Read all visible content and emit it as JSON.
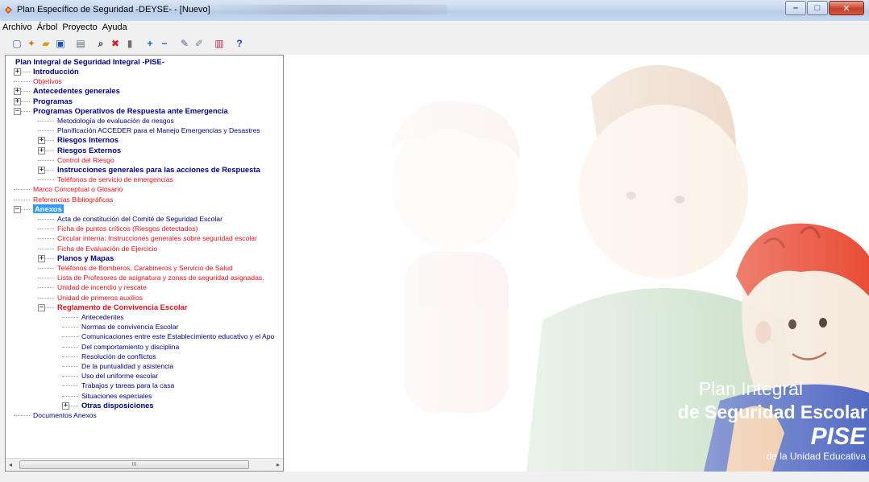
{
  "window": {
    "title": "Plan Específico de Seguridad -DEYSE- - [Nuevo]",
    "controls": {
      "minimize": "–",
      "maximize": "□",
      "close": "✕"
    }
  },
  "menu": [
    "Archivo",
    "Árbol",
    "Proyecto",
    "Ayuda"
  ],
  "toolbar": [
    {
      "icon": "new-document-icon",
      "glyph": "▢",
      "color": "#3060c0"
    },
    {
      "icon": "wand-icon",
      "glyph": "✦",
      "color": "#c08020"
    },
    {
      "icon": "open-folder-icon",
      "glyph": "▰",
      "color": "#d0a020"
    },
    {
      "icon": "save-icon",
      "glyph": "▣",
      "color": "#2050b0"
    },
    {
      "icon": "sep"
    },
    {
      "icon": "print-preview-icon",
      "glyph": "▤",
      "color": "#607080"
    },
    {
      "icon": "sep"
    },
    {
      "icon": "find-icon",
      "glyph": "⌕",
      "color": "#333333"
    },
    {
      "icon": "delete-icon",
      "glyph": "✖",
      "color": "#d02020"
    },
    {
      "icon": "trash-icon",
      "glyph": "▮",
      "color": "#707070"
    },
    {
      "icon": "sep"
    },
    {
      "icon": "add-node-icon",
      "glyph": "+",
      "color": "#1060d0"
    },
    {
      "icon": "remove-node-icon",
      "glyph": "−",
      "color": "#1060d0"
    },
    {
      "icon": "sep"
    },
    {
      "icon": "edit-icon",
      "glyph": "✎",
      "color": "#506080"
    },
    {
      "icon": "edit-text-icon",
      "glyph": "✐",
      "color": "#7080a0"
    },
    {
      "icon": "sep"
    },
    {
      "icon": "report-icon",
      "glyph": "▥",
      "color": "#c02060"
    },
    {
      "icon": "sep"
    },
    {
      "icon": "help-icon",
      "glyph": "?",
      "color": "#2040c0"
    }
  ],
  "tree": {
    "root": "Plan Integral de Seguridad Integral -PISE-",
    "nodes": [
      {
        "label": "Introducción",
        "level": 1,
        "style": "bold-blue",
        "expander": "+"
      },
      {
        "label": "Objetivos",
        "level": 1,
        "style": "red"
      },
      {
        "label": "Antecedentes generales",
        "level": 1,
        "style": "bold-blue",
        "expander": "+"
      },
      {
        "label": "Programas",
        "level": 1,
        "style": "bold-blue",
        "expander": "+"
      },
      {
        "label": "Programas Operativos de Respuesta ante Emergencia",
        "level": 1,
        "style": "bold-blue",
        "expander": "−"
      },
      {
        "label": "Metodología de evaluación de riesgos",
        "level": 2,
        "style": "blue"
      },
      {
        "label": "Planificación ACCEDER para el Manejo Emergencias y Desastres",
        "level": 2,
        "style": "blue"
      },
      {
        "label": "Riesgos Internos",
        "level": 2,
        "style": "bold-blue",
        "expander": "+"
      },
      {
        "label": "Riesgos Externos",
        "level": 2,
        "style": "bold-blue",
        "expander": "+"
      },
      {
        "label": "Control del Riesgo",
        "level": 2,
        "style": "red"
      },
      {
        "label": "Instrucciones generales para las acciones de Respuesta",
        "level": 2,
        "style": "bold-blue",
        "expander": "+"
      },
      {
        "label": "Teléfonos de servicio de emergencias",
        "level": 2,
        "style": "red"
      },
      {
        "label": "Marco Conceptual o Glosario",
        "level": 1,
        "style": "red"
      },
      {
        "label": "Referencias Bibliográficas",
        "level": 1,
        "style": "red"
      },
      {
        "label": "Anexos",
        "level": 1,
        "style": "bold-selected",
        "expander": "−"
      },
      {
        "label": "Acta de constitución del Comité de Seguridad Escolar",
        "level": 2,
        "style": "blue"
      },
      {
        "label": "Ficha de puntos críticos (Riesgos detectados)",
        "level": 2,
        "style": "red"
      },
      {
        "label": "Circular interna: Instrucciones generales sobre seguridad escolar",
        "level": 2,
        "style": "red"
      },
      {
        "label": "Ficha de Evaluación de Ejercicio",
        "level": 2,
        "style": "red"
      },
      {
        "label": "Planos y Mapas",
        "level": 2,
        "style": "bold-blue",
        "expander": "+"
      },
      {
        "label": "Teléfonos de Bomberos, Carabineros y Servicio de Salud",
        "level": 2,
        "style": "red"
      },
      {
        "label": "Lista de Profesores de asignatura y zonas de seguridad asignadas.",
        "level": 2,
        "style": "red"
      },
      {
        "label": "Unidad de incendio y rescate",
        "level": 2,
        "style": "red"
      },
      {
        "label": "Unidad de primeros auxilios",
        "level": 2,
        "style": "red"
      },
      {
        "label": "Reglamento de Convivencia Escolar",
        "level": 2,
        "style": "bold-red",
        "expander": "−"
      },
      {
        "label": "Antecedentes",
        "level": 3,
        "style": "blue"
      },
      {
        "label": "Normas de convivencia Escolar",
        "level": 3,
        "style": "blue"
      },
      {
        "label": "Comunicaciones entre este Establecimiento educativo y el Apo",
        "level": 3,
        "style": "blue"
      },
      {
        "label": "Del comportamiento y disciplina",
        "level": 3,
        "style": "blue"
      },
      {
        "label": "Resolución de conflictos",
        "level": 3,
        "style": "blue"
      },
      {
        "label": "De la puntualidad y asistencia",
        "level": 3,
        "style": "blue"
      },
      {
        "label": "Uso del uniforme escolar",
        "level": 3,
        "style": "blue"
      },
      {
        "label": "Trabajos y tareas para la casa",
        "level": 3,
        "style": "blue"
      },
      {
        "label": "Situaciones especiales",
        "level": 3,
        "style": "blue"
      },
      {
        "label": "Otras disposiciones",
        "level": 3,
        "style": "bold-blue",
        "expander": "+"
      },
      {
        "label": "Documentos Anexos",
        "level": 1,
        "style": "blue"
      }
    ],
    "scrollbar": {
      "left_arrow": "◂",
      "right_arrow": "▸",
      "grip": "III"
    }
  },
  "splash": {
    "line1": "Plan Integral",
    "line2": "de Seguridad Escolar",
    "line3": "PISE",
    "line4": "de la Unidad Educativa"
  }
}
